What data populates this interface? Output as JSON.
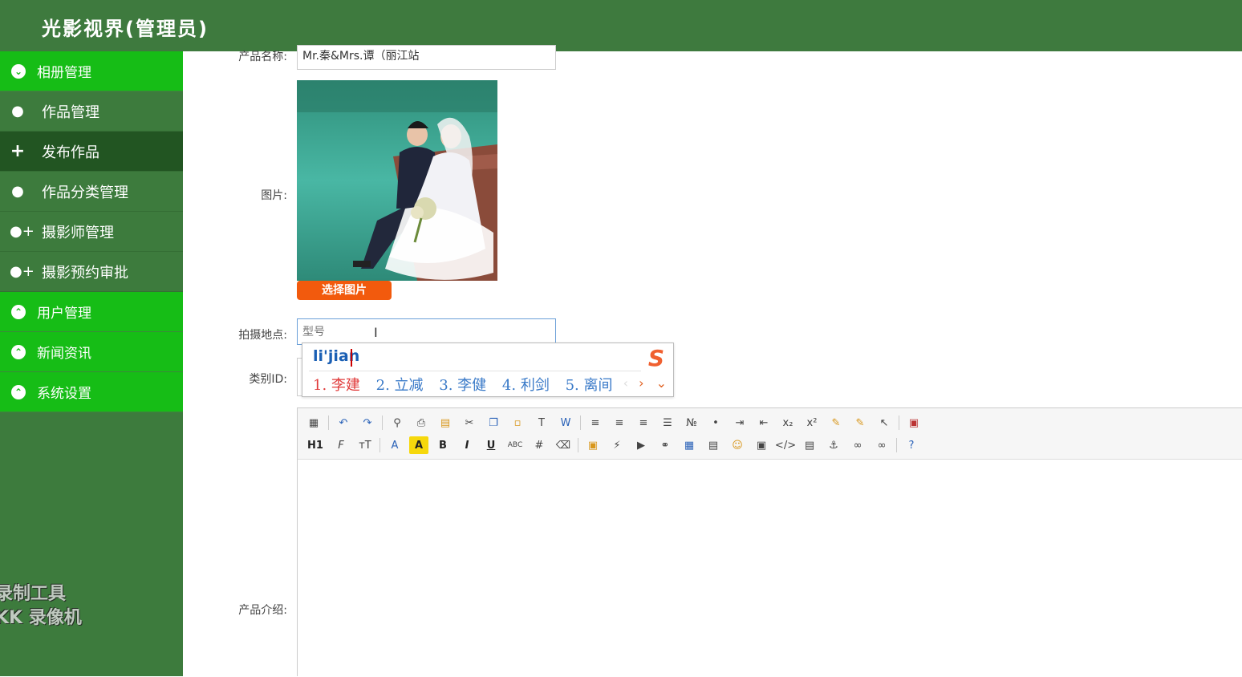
{
  "header": {
    "title": "光影视界(管理员)"
  },
  "sidebar": {
    "items": [
      {
        "label": "相册管理",
        "type": "group",
        "icon": "chevron-down-circle-icon"
      },
      {
        "label": "作品管理",
        "type": "sub",
        "icon": "user-icon"
      },
      {
        "label": "发布作品",
        "type": "sub",
        "icon": "plus-icon",
        "active": true
      },
      {
        "label": "作品分类管理",
        "type": "sub",
        "icon": "user-icon"
      },
      {
        "label": "摄影师管理",
        "type": "sub",
        "icon": "add-user-icon"
      },
      {
        "label": "摄影预约审批",
        "type": "sub",
        "icon": "add-user-icon"
      },
      {
        "label": "用户管理",
        "type": "group",
        "icon": "chevron-up-circle-icon"
      },
      {
        "label": "新闻资讯",
        "type": "group",
        "icon": "chevron-up-circle-icon"
      },
      {
        "label": "系统设置",
        "type": "group",
        "icon": "chevron-up-circle-icon"
      }
    ],
    "watermark": [
      "录制工具",
      "KK 录像机"
    ]
  },
  "form": {
    "product_name_label": "产品名称:",
    "product_name_value": "Mr.秦&Mrs.谭（丽江站",
    "image_label": "图片:",
    "choose_image_button": "选择图片",
    "location_label": "拍摄地点:",
    "location_placeholder": "型号",
    "category_label": "类别ID:",
    "intro_label": "产品介绍:"
  },
  "ime": {
    "pinyin": "li'jian",
    "candidates": [
      "1. 李建",
      "2. 立减",
      "3. 李健",
      "4. 利剑",
      "5. 离间"
    ]
  },
  "editor": {
    "row1": [
      "source",
      "|",
      "undo",
      "redo",
      "|",
      "preview",
      "print",
      "template",
      "cut",
      "copy",
      "paste",
      "paste-plain",
      "paste-word",
      "|",
      "align-left",
      "align-center",
      "align-right",
      "justify",
      "ordered-list",
      "unordered-list",
      "indent",
      "outdent",
      "subscript",
      "superscript",
      "clear-format",
      "select-all",
      "select",
      "|",
      "fullscreen"
    ],
    "row2": [
      "heading",
      "font-family",
      "font-size",
      "|",
      "font-color",
      "highlight",
      "bold",
      "italic",
      "underline",
      "strikethrough",
      "line-height",
      "eraser",
      "|",
      "image",
      "flash",
      "media",
      "attachment",
      "table",
      "insert-row",
      "emoticon",
      "map",
      "code",
      "page-break",
      "anchor",
      "link",
      "unlink",
      "|",
      "help"
    ]
  },
  "colors": {
    "header": "#3e7a3e",
    "sidebar": "#3d7b3d",
    "group": "#16bd16",
    "active": "#225522",
    "button": "#f25a0d"
  }
}
